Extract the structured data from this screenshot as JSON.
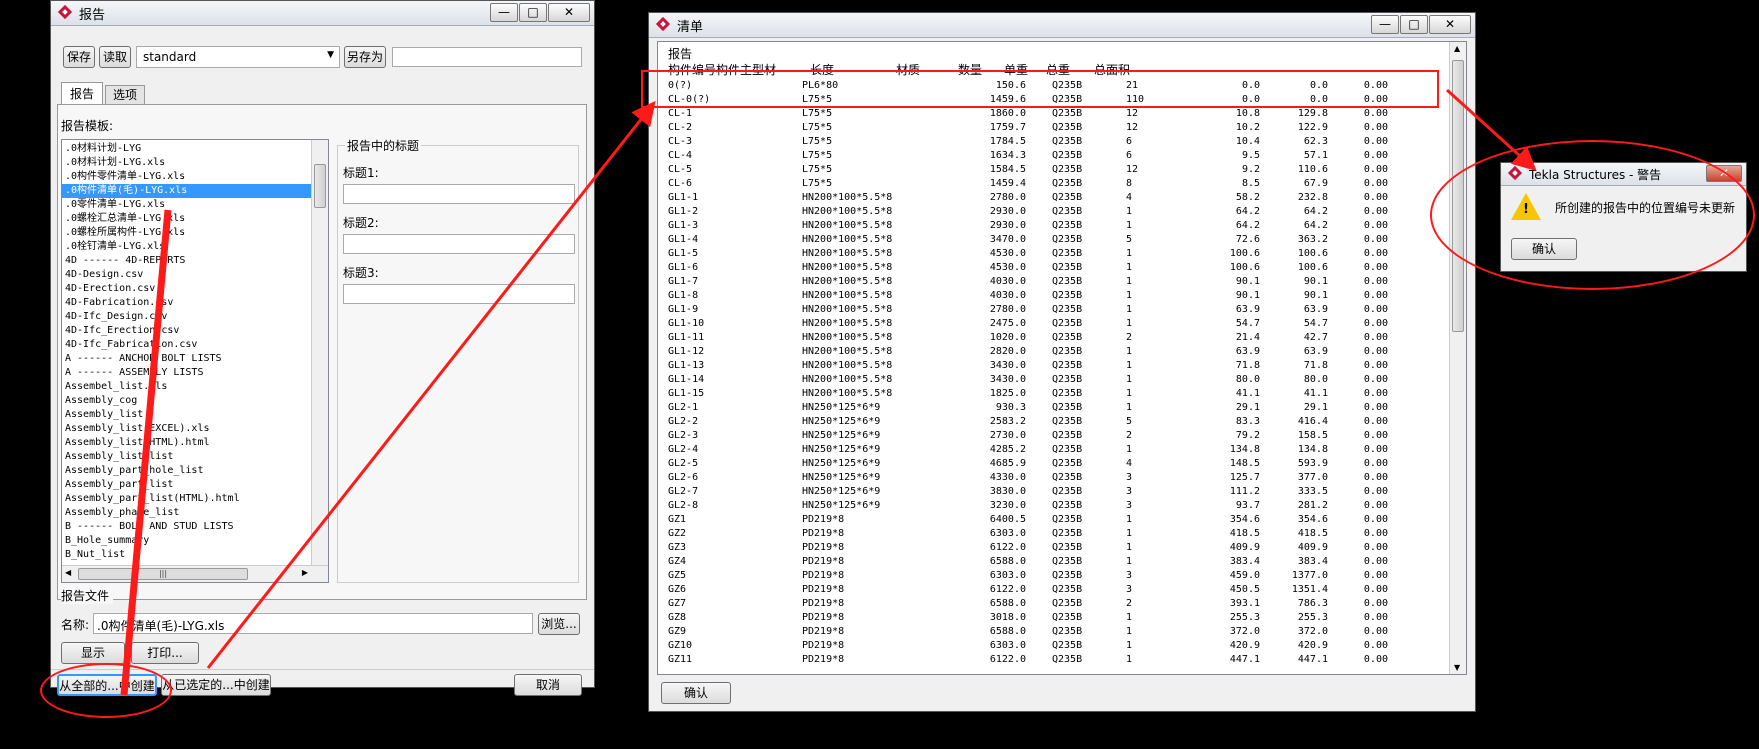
{
  "report_window": {
    "title": "报告",
    "toolbar": {
      "save": "保存",
      "load": "读取",
      "preset": "standard",
      "save_as": "另存为",
      "save_as_value": ""
    },
    "tabs": [
      "报告",
      "选项"
    ],
    "templates_label": "报告模板:",
    "templates": [
      ".0材料计划-LYG",
      ".0材料计划-LYG.xls",
      ".0构件零件清单-LYG.xls",
      ".0构件清单(毛)-LYG.xls",
      ".0零件清单-LYG.xls",
      ".0螺栓汇总清单-LYG.xls",
      ".0螺栓所属构件-LYG.xls",
      ".0栓钉清单-LYG.xls",
      "4D ------ 4D-REPORTS",
      "4D-Design.csv",
      "4D-Erection.csv",
      "4D-Fabrication.csv",
      "4D-Ifc_Design.csv",
      "4D-Ifc_Erection.csv",
      "4D-Ifc_Fabrication.csv",
      "A ------ ANCHOR BOLT LISTS",
      "A ------ ASSEMBLY LISTS",
      "Assembel_list.xls",
      "Assembly_cog",
      "Assembly_list",
      "Assembly_list(EXCEL).xls",
      "Assembly_list(HTML).html",
      "Assembly_list_list",
      "Assembly_part_hole_list",
      "Assembly_part_list",
      "Assembly_part_list(HTML).html",
      "Assembly_phase_list",
      "B ------ BOLT AND STUD LISTS",
      "B_Hole_summary",
      "B_Nut_list"
    ],
    "selected_index": 3,
    "headings_group": "报告中的标题",
    "heading1": "标题1:",
    "heading2": "标题2:",
    "heading3": "标题3:",
    "heading1_value": "",
    "heading2_value": "",
    "heading3_value": "",
    "report_file_label": "报告文件",
    "name_label": "名称:",
    "name_value": ".0构件清单(毛)-LYG.xls",
    "browse": "浏览...",
    "show": "显示",
    "print": "打印...",
    "create_all": "从全部的...中创建",
    "create_selected": "从已选定的...中创建",
    "cancel": "取消",
    "hscroll_grip": "|||"
  },
  "list_window": {
    "title": "清单",
    "header_title": "报告",
    "columns": [
      "构件编号",
      "构件主型材",
      "长度",
      "材质",
      "数量",
      "单重",
      "总重",
      "总面积"
    ],
    "rows": [
      [
        "0(?)",
        "PL6*80",
        "150.6",
        "Q235B",
        "21",
        "0.0",
        "0.0",
        "0.00"
      ],
      [
        "CL-0(?)",
        "L75*5",
        "1459.6",
        "Q235B",
        "110",
        "0.0",
        "0.0",
        "0.00"
      ],
      [
        "CL-1",
        "L75*5",
        "1860.0",
        "Q235B",
        "12",
        "10.8",
        "129.8",
        "0.00"
      ],
      [
        "CL-2",
        "L75*5",
        "1759.7",
        "Q235B",
        "12",
        "10.2",
        "122.9",
        "0.00"
      ],
      [
        "CL-3",
        "L75*5",
        "1784.5",
        "Q235B",
        "6",
        "10.4",
        "62.3",
        "0.00"
      ],
      [
        "CL-4",
        "L75*5",
        "1634.3",
        "Q235B",
        "6",
        "9.5",
        "57.1",
        "0.00"
      ],
      [
        "CL-5",
        "L75*5",
        "1584.5",
        "Q235B",
        "12",
        "9.2",
        "110.6",
        "0.00"
      ],
      [
        "CL-6",
        "L75*5",
        "1459.4",
        "Q235B",
        "8",
        "8.5",
        "67.9",
        "0.00"
      ],
      [
        "GL1-1",
        "HN200*100*5.5*8",
        "2780.0",
        "Q235B",
        "4",
        "58.2",
        "232.8",
        "0.00"
      ],
      [
        "GL1-2",
        "HN200*100*5.5*8",
        "2930.0",
        "Q235B",
        "1",
        "64.2",
        "64.2",
        "0.00"
      ],
      [
        "GL1-3",
        "HN200*100*5.5*8",
        "2930.0",
        "Q235B",
        "1",
        "64.2",
        "64.2",
        "0.00"
      ],
      [
        "GL1-4",
        "HN200*100*5.5*8",
        "3470.0",
        "Q235B",
        "5",
        "72.6",
        "363.2",
        "0.00"
      ],
      [
        "GL1-5",
        "HN200*100*5.5*8",
        "4530.0",
        "Q235B",
        "1",
        "100.6",
        "100.6",
        "0.00"
      ],
      [
        "GL1-6",
        "HN200*100*5.5*8",
        "4530.0",
        "Q235B",
        "1",
        "100.6",
        "100.6",
        "0.00"
      ],
      [
        "GL1-7",
        "HN200*100*5.5*8",
        "4030.0",
        "Q235B",
        "1",
        "90.1",
        "90.1",
        "0.00"
      ],
      [
        "GL1-8",
        "HN200*100*5.5*8",
        "4030.0",
        "Q235B",
        "1",
        "90.1",
        "90.1",
        "0.00"
      ],
      [
        "GL1-9",
        "HN200*100*5.5*8",
        "2780.0",
        "Q235B",
        "1",
        "63.9",
        "63.9",
        "0.00"
      ],
      [
        "GL1-10",
        "HN200*100*5.5*8",
        "2475.0",
        "Q235B",
        "1",
        "54.7",
        "54.7",
        "0.00"
      ],
      [
        "GL1-11",
        "HN200*100*5.5*8",
        "1020.0",
        "Q235B",
        "2",
        "21.4",
        "42.7",
        "0.00"
      ],
      [
        "GL1-12",
        "HN200*100*5.5*8",
        "2820.0",
        "Q235B",
        "1",
        "63.9",
        "63.9",
        "0.00"
      ],
      [
        "GL1-13",
        "HN200*100*5.5*8",
        "3430.0",
        "Q235B",
        "1",
        "71.8",
        "71.8",
        "0.00"
      ],
      [
        "GL1-14",
        "HN200*100*5.5*8",
        "3430.0",
        "Q235B",
        "1",
        "80.0",
        "80.0",
        "0.00"
      ],
      [
        "GL1-15",
        "HN200*100*5.5*8",
        "1825.0",
        "Q235B",
        "1",
        "41.1",
        "41.1",
        "0.00"
      ],
      [
        "GL2-1",
        "HN250*125*6*9",
        "930.3",
        "Q235B",
        "1",
        "29.1",
        "29.1",
        "0.00"
      ],
      [
        "GL2-2",
        "HN250*125*6*9",
        "2583.2",
        "Q235B",
        "5",
        "83.3",
        "416.4",
        "0.00"
      ],
      [
        "GL2-3",
        "HN250*125*6*9",
        "2730.0",
        "Q235B",
        "2",
        "79.2",
        "158.5",
        "0.00"
      ],
      [
        "GL2-4",
        "HN250*125*6*9",
        "4285.2",
        "Q235B",
        "1",
        "134.8",
        "134.8",
        "0.00"
      ],
      [
        "GL2-5",
        "HN250*125*6*9",
        "4685.9",
        "Q235B",
        "4",
        "148.5",
        "593.9",
        "0.00"
      ],
      [
        "GL2-6",
        "HN250*125*6*9",
        "4330.0",
        "Q235B",
        "3",
        "125.7",
        "377.0",
        "0.00"
      ],
      [
        "GL2-7",
        "HN250*125*6*9",
        "3830.0",
        "Q235B",
        "3",
        "111.2",
        "333.5",
        "0.00"
      ],
      [
        "GL2-8",
        "HN250*125*6*9",
        "3230.0",
        "Q235B",
        "3",
        "93.7",
        "281.2",
        "0.00"
      ],
      [
        "GZ1",
        "PD219*8",
        "6400.5",
        "Q235B",
        "1",
        "354.6",
        "354.6",
        "0.00"
      ],
      [
        "GZ2",
        "PD219*8",
        "6303.0",
        "Q235B",
        "1",
        "418.5",
        "418.5",
        "0.00"
      ],
      [
        "GZ3",
        "PD219*8",
        "6122.0",
        "Q235B",
        "1",
        "409.9",
        "409.9",
        "0.00"
      ],
      [
        "GZ4",
        "PD219*8",
        "6588.0",
        "Q235B",
        "1",
        "383.4",
        "383.4",
        "0.00"
      ],
      [
        "GZ5",
        "PD219*8",
        "6303.0",
        "Q235B",
        "3",
        "459.0",
        "1377.0",
        "0.00"
      ],
      [
        "GZ6",
        "PD219*8",
        "6122.0",
        "Q235B",
        "3",
        "450.5",
        "1351.4",
        "0.00"
      ],
      [
        "GZ7",
        "PD219*8",
        "6588.0",
        "Q235B",
        "2",
        "393.1",
        "786.3",
        "0.00"
      ],
      [
        "GZ8",
        "PD219*8",
        "3018.0",
        "Q235B",
        "1",
        "255.3",
        "255.3",
        "0.00"
      ],
      [
        "GZ9",
        "PD219*8",
        "6588.0",
        "Q235B",
        "1",
        "372.0",
        "372.0",
        "0.00"
      ],
      [
        "GZ10",
        "PD219*8",
        "6303.0",
        "Q235B",
        "1",
        "420.9",
        "420.9",
        "0.00"
      ],
      [
        "GZ11",
        "PD219*8",
        "6122.0",
        "Q235B",
        "1",
        "447.1",
        "447.1",
        "0.00"
      ]
    ],
    "ok": "确认"
  },
  "warning": {
    "title": "Tekla Structures - 警告",
    "message": "所创建的报告中的位置编号未更新",
    "ok": "确认"
  },
  "colors": {
    "annotation_red": "#ff1a1a",
    "selection": "#3399ff",
    "tekla_logo": "#c8143c"
  }
}
